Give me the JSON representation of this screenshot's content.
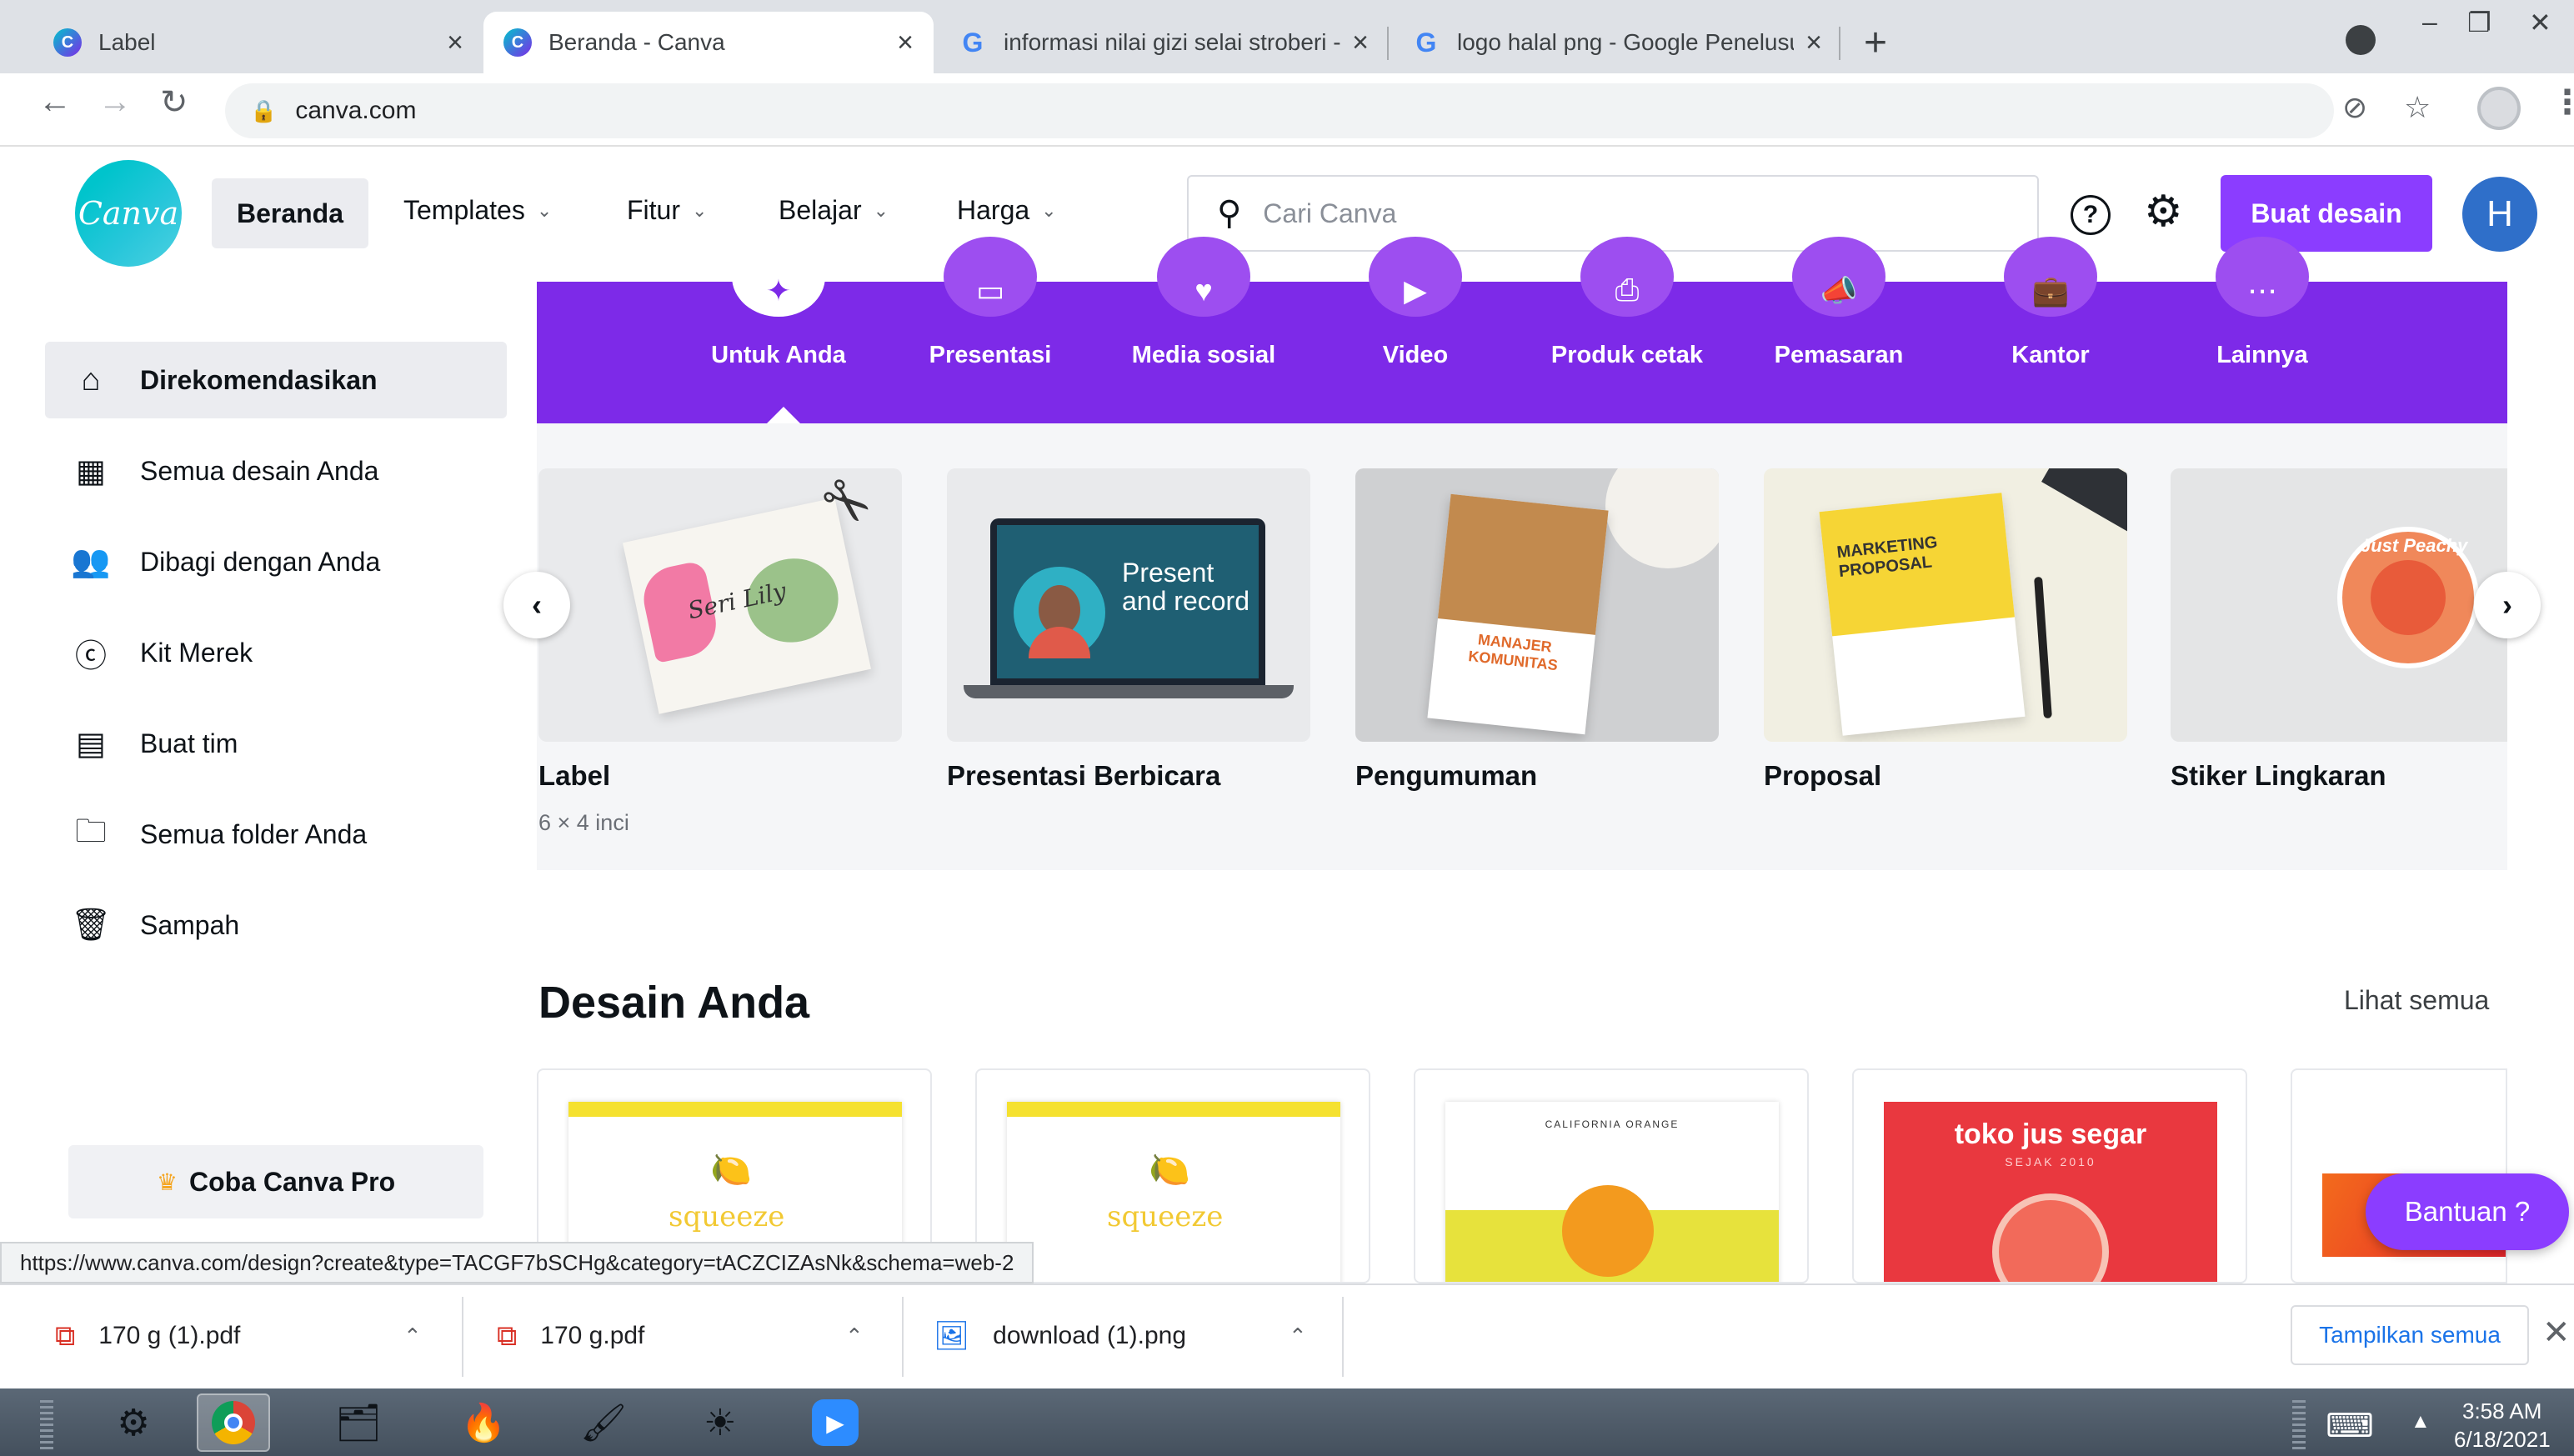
{
  "browser": {
    "tabs": [
      {
        "title": "Label",
        "favicon": "canva"
      },
      {
        "title": "Beranda - Canva",
        "favicon": "canva"
      },
      {
        "title": "informasi nilai gizi selai stroberi - ",
        "favicon": "google"
      },
      {
        "title": "logo halal png - Google Penelusu",
        "favicon": "google"
      }
    ],
    "url": "canva.com"
  },
  "header": {
    "logo_text": "Canva",
    "home": "Beranda",
    "nav": [
      "Templates",
      "Fitur",
      "Belajar",
      "Harga"
    ],
    "search_placeholder": "Cari Canva",
    "create_button": "Buat desain",
    "avatar_initial": "H",
    "accent": "#8b3dff"
  },
  "sidebar": {
    "items": [
      {
        "label": "Direkomendasikan",
        "icon": "home-icon",
        "active": true
      },
      {
        "label": "Semua desain Anda",
        "icon": "grid-icon"
      },
      {
        "label": "Dibagi dengan Anda",
        "icon": "shared-users-icon"
      },
      {
        "label": "Kit Merek",
        "icon": "brand-kit-icon"
      },
      {
        "label": "Buat tim",
        "icon": "team-icon"
      },
      {
        "label": "Semua folder Anda",
        "icon": "folder-icon"
      },
      {
        "label": "Sampah",
        "icon": "trash-icon"
      }
    ],
    "pro_button": "Coba Canva Pro"
  },
  "categories": {
    "items": [
      "Untuk Anda",
      "Presentasi",
      "Media sosial",
      "Video",
      "Produk cetak",
      "Pemasaran",
      "Kantor",
      "Lainnya"
    ],
    "active": "Untuk Anda",
    "band_color": "#7d2ae8"
  },
  "templates": [
    {
      "title": "Label",
      "subtitle": "6 × 4 inci",
      "thumb_text": "Seri Lily"
    },
    {
      "title": "Presentasi Berbicara",
      "thumb_text": "Present and record"
    },
    {
      "title": "Pengumuman",
      "thumb_text": "MANAJER KOMUNITAS"
    },
    {
      "title": "Proposal",
      "thumb_text": "MARKETING PROPOSAL"
    },
    {
      "title": "Stiker Lingkaran",
      "thumb_text": "Just Peachy"
    }
  ],
  "designs": {
    "title": "Desain Anda",
    "see_all": "Lihat semua",
    "items": [
      {
        "thumb_text": "squeeze"
      },
      {
        "thumb_text": "squeeze"
      },
      {
        "thumb_text": "CALIFORNIA ORANGE"
      },
      {
        "thumb_text": "toko jus segar",
        "thumb_sub": "SEJAK 2010"
      }
    ]
  },
  "help_button": "Bantuan ?",
  "status_url": "https://www.canva.com/design?create&type=TACGF7bSCHg&category=tACZCIZAsNk&schema=web-2",
  "downloads": {
    "items": [
      {
        "name": "170 g (1).pdf",
        "type": "pdf"
      },
      {
        "name": "170 g.pdf",
        "type": "pdf"
      },
      {
        "name": "download (1).png",
        "type": "image"
      }
    ],
    "show_all": "Tampilkan semua"
  },
  "taskbar": {
    "time": "3:58 AM",
    "date": "6/18/2021"
  }
}
